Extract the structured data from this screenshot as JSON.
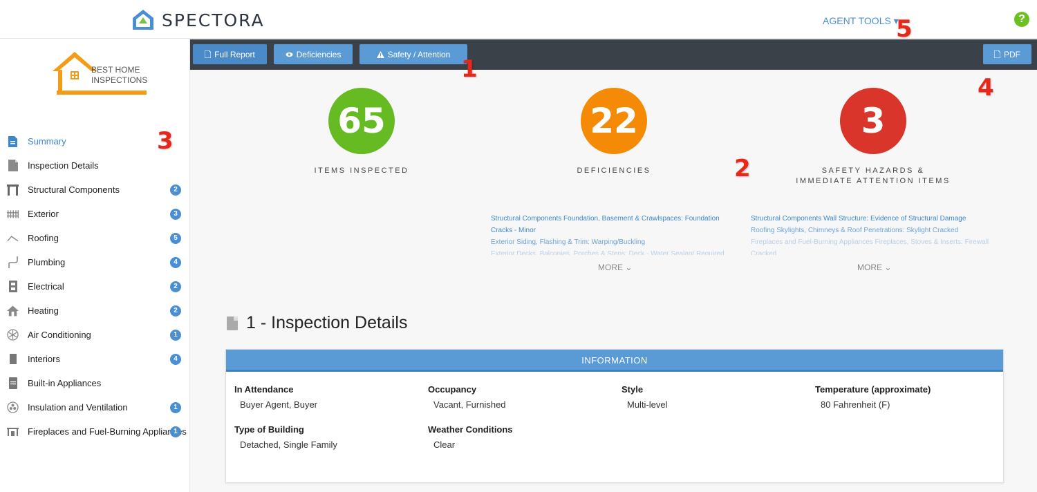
{
  "header": {
    "brand": "SPECTORA",
    "agent_tools": "AGENT TOOLS ▾",
    "help": "?"
  },
  "callouts": [
    "1",
    "2",
    "3",
    "4",
    "5"
  ],
  "sidebar": {
    "company_logo_text": [
      "BEST HOME",
      "INSPECTIONS"
    ],
    "items": [
      {
        "label": "Summary",
        "badge": "",
        "icon": "document-icon"
      },
      {
        "label": "Inspection Details",
        "badge": "",
        "icon": "file-icon"
      },
      {
        "label": "Structural Components",
        "badge": "2",
        "icon": "columns-icon"
      },
      {
        "label": "Exterior",
        "badge": "3",
        "icon": "fence-icon"
      },
      {
        "label": "Roofing",
        "badge": "5",
        "icon": "roof-icon"
      },
      {
        "label": "Plumbing",
        "badge": "4",
        "icon": "pipe-icon"
      },
      {
        "label": "Electrical",
        "badge": "2",
        "icon": "electrical-panel-icon"
      },
      {
        "label": "Heating",
        "badge": "2",
        "icon": "house-heat-icon"
      },
      {
        "label": "Air Conditioning",
        "badge": "1",
        "icon": "snowflake-icon"
      },
      {
        "label": "Interiors",
        "badge": "4",
        "icon": "door-icon"
      },
      {
        "label": "Built-in Appliances",
        "badge": "",
        "icon": "appliance-icon"
      },
      {
        "label": "Insulation and Ventilation",
        "badge": "1",
        "icon": "fan-icon"
      },
      {
        "label": "Fireplaces and Fuel-Burning Appliances",
        "badge": "1",
        "icon": "fireplace-icon"
      }
    ]
  },
  "toolbar": {
    "full_report": "Full Report",
    "deficiencies": "Deficiencies",
    "safety": "Safety / Attention",
    "pdf": "PDF"
  },
  "stats": {
    "items_inspected": {
      "value": "65",
      "label": "ITEMS INSPECTED",
      "color": "#66bb22"
    },
    "deficiencies": {
      "value": "22",
      "label": "DEFICIENCIES",
      "color": "#f58a07"
    },
    "safety": {
      "value": "3",
      "label1": "SAFETY HAZARDS &",
      "label2": "IMMEDIATE ATTENTION ITEMS",
      "color": "#d9352b"
    }
  },
  "deficiency_list": [
    "Structural Components Foundation, Basement & Crawlspaces: Foundation Cracks - Minor",
    "Exterior Siding, Flashing & Trim: Warping/Buckling",
    "Exterior Decks, Balconies, Porches & Steps: Deck - Water Sealant Required"
  ],
  "safety_list": [
    "Structural Components Wall Structure: Evidence of Structural Damage",
    "Roofing Skylights, Chimneys & Roof Penetrations: Skylight Cracked",
    "Fireplaces and Fuel-Burning Appliances Fireplaces, Stoves & Inserts: Firewall Cracked"
  ],
  "more_label": "MORE",
  "section": {
    "title": "1 - Inspection Details",
    "card_header": "INFORMATION",
    "fields": [
      {
        "key": "In Attendance",
        "value": "Buyer Agent, Buyer"
      },
      {
        "key": "Occupancy",
        "value": "Vacant, Furnished"
      },
      {
        "key": "Style",
        "value": "Multi-level"
      },
      {
        "key": "Temperature (approximate)",
        "value": "80 Fahrenheit (F)"
      },
      {
        "key": "Type of Building",
        "value": "Detached, Single Family"
      },
      {
        "key": "Weather Conditions",
        "value": "Clear"
      }
    ]
  }
}
